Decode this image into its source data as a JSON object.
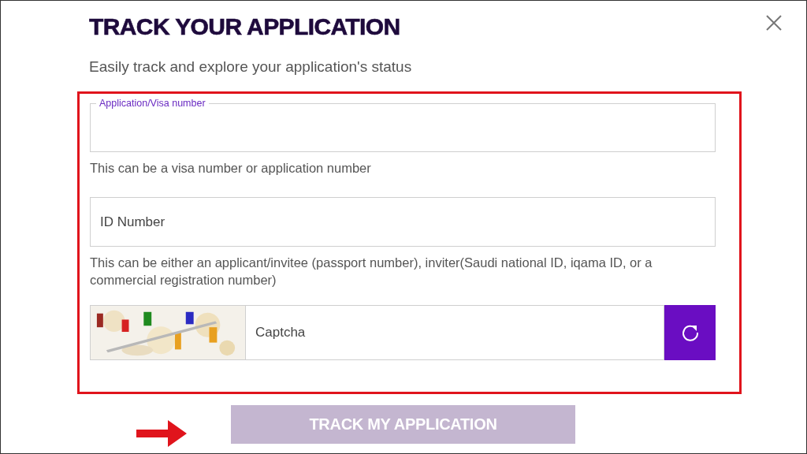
{
  "dialog": {
    "title": "TRACK YOUR APPLICATION",
    "subtitle": "Easily track and explore your application's status"
  },
  "fields": [
    {
      "kind": "outlined",
      "label": "Application/Visa number",
      "hint": "This can be a visa number or application number"
    },
    {
      "kind": "plain",
      "placeholder": "ID Number",
      "hint": "This can be either an applicant/invitee (passport number), inviter(Saudi national ID, iqama ID, or a commercial registration number)"
    }
  ],
  "captcha": {
    "placeholder": "Captcha"
  },
  "submit": {
    "label": "TRACK MY APPLICATION",
    "disabled": true
  }
}
